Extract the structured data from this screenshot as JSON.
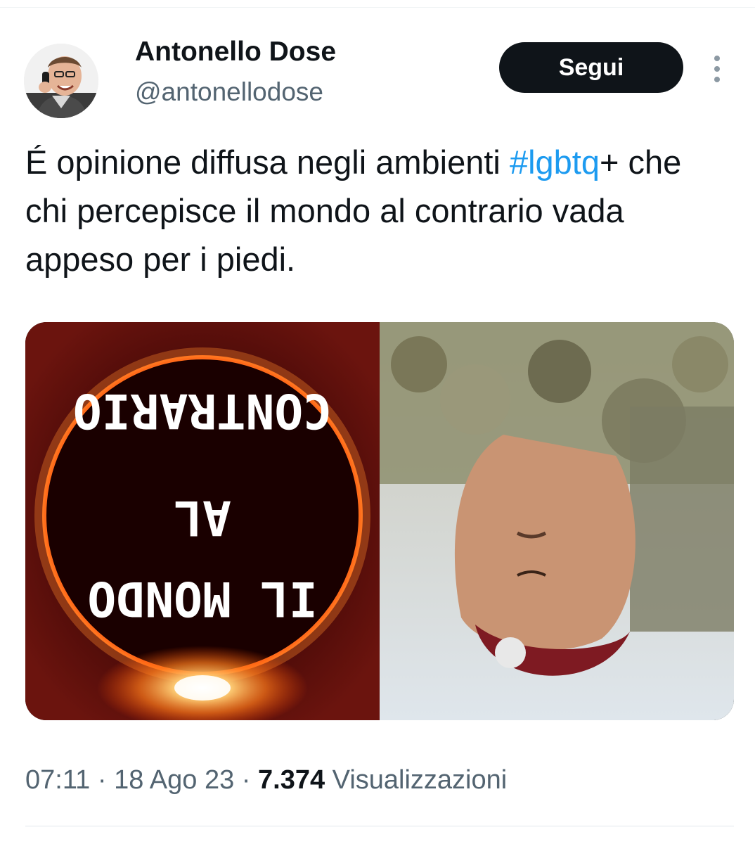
{
  "author": {
    "display_name": "Antonello Dose",
    "handle": "@antonellodose"
  },
  "follow_button": {
    "label": "Segui"
  },
  "more_button": {
    "icon": "more-vertical-icon"
  },
  "tweet": {
    "text_before_hashtag": "É opinione diffusa negli ambienti ",
    "hashtag": "#lgbtq",
    "text_after_hashtag": "+ che chi percepisce il mondo al contrario vada appeso per i piedi."
  },
  "media": {
    "left_panel": {
      "line1": "CONTRARIO",
      "line2": "AL",
      "line3": "IL MONDO"
    }
  },
  "meta": {
    "time": "07:11",
    "sep1": " · ",
    "date": "18 Ago 23",
    "sep2": " · ",
    "views_count": "7.374",
    "views_label": " Visualizzazioni"
  },
  "colors": {
    "text_primary": "#0f1419",
    "text_secondary": "#536471",
    "link": "#1d9bf0",
    "follow_bg": "#0f1419"
  }
}
